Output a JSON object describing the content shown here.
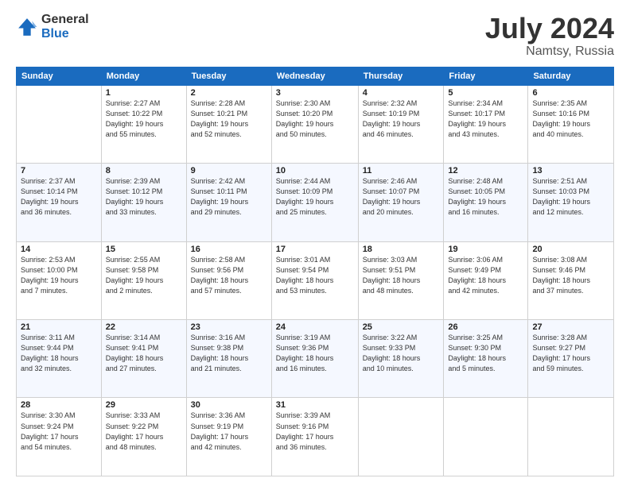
{
  "logo": {
    "general": "General",
    "blue": "Blue"
  },
  "title": {
    "month_year": "July 2024",
    "location": "Namtsy, Russia"
  },
  "calendar": {
    "headers": [
      "Sunday",
      "Monday",
      "Tuesday",
      "Wednesday",
      "Thursday",
      "Friday",
      "Saturday"
    ],
    "weeks": [
      [
        {
          "day": "",
          "info": ""
        },
        {
          "day": "1",
          "info": "Sunrise: 2:27 AM\nSunset: 10:22 PM\nDaylight: 19 hours\nand 55 minutes."
        },
        {
          "day": "2",
          "info": "Sunrise: 2:28 AM\nSunset: 10:21 PM\nDaylight: 19 hours\nand 52 minutes."
        },
        {
          "day": "3",
          "info": "Sunrise: 2:30 AM\nSunset: 10:20 PM\nDaylight: 19 hours\nand 50 minutes."
        },
        {
          "day": "4",
          "info": "Sunrise: 2:32 AM\nSunset: 10:19 PM\nDaylight: 19 hours\nand 46 minutes."
        },
        {
          "day": "5",
          "info": "Sunrise: 2:34 AM\nSunset: 10:17 PM\nDaylight: 19 hours\nand 43 minutes."
        },
        {
          "day": "6",
          "info": "Sunrise: 2:35 AM\nSunset: 10:16 PM\nDaylight: 19 hours\nand 40 minutes."
        }
      ],
      [
        {
          "day": "7",
          "info": "Sunrise: 2:37 AM\nSunset: 10:14 PM\nDaylight: 19 hours\nand 36 minutes."
        },
        {
          "day": "8",
          "info": "Sunrise: 2:39 AM\nSunset: 10:12 PM\nDaylight: 19 hours\nand 33 minutes."
        },
        {
          "day": "9",
          "info": "Sunrise: 2:42 AM\nSunset: 10:11 PM\nDaylight: 19 hours\nand 29 minutes."
        },
        {
          "day": "10",
          "info": "Sunrise: 2:44 AM\nSunset: 10:09 PM\nDaylight: 19 hours\nand 25 minutes."
        },
        {
          "day": "11",
          "info": "Sunrise: 2:46 AM\nSunset: 10:07 PM\nDaylight: 19 hours\nand 20 minutes."
        },
        {
          "day": "12",
          "info": "Sunrise: 2:48 AM\nSunset: 10:05 PM\nDaylight: 19 hours\nand 16 minutes."
        },
        {
          "day": "13",
          "info": "Sunrise: 2:51 AM\nSunset: 10:03 PM\nDaylight: 19 hours\nand 12 minutes."
        }
      ],
      [
        {
          "day": "14",
          "info": "Sunrise: 2:53 AM\nSunset: 10:00 PM\nDaylight: 19 hours\nand 7 minutes."
        },
        {
          "day": "15",
          "info": "Sunrise: 2:55 AM\nSunset: 9:58 PM\nDaylight: 19 hours\nand 2 minutes."
        },
        {
          "day": "16",
          "info": "Sunrise: 2:58 AM\nSunset: 9:56 PM\nDaylight: 18 hours\nand 57 minutes."
        },
        {
          "day": "17",
          "info": "Sunrise: 3:01 AM\nSunset: 9:54 PM\nDaylight: 18 hours\nand 53 minutes."
        },
        {
          "day": "18",
          "info": "Sunrise: 3:03 AM\nSunset: 9:51 PM\nDaylight: 18 hours\nand 48 minutes."
        },
        {
          "day": "19",
          "info": "Sunrise: 3:06 AM\nSunset: 9:49 PM\nDaylight: 18 hours\nand 42 minutes."
        },
        {
          "day": "20",
          "info": "Sunrise: 3:08 AM\nSunset: 9:46 PM\nDaylight: 18 hours\nand 37 minutes."
        }
      ],
      [
        {
          "day": "21",
          "info": "Sunrise: 3:11 AM\nSunset: 9:44 PM\nDaylight: 18 hours\nand 32 minutes."
        },
        {
          "day": "22",
          "info": "Sunrise: 3:14 AM\nSunset: 9:41 PM\nDaylight: 18 hours\nand 27 minutes."
        },
        {
          "day": "23",
          "info": "Sunrise: 3:16 AM\nSunset: 9:38 PM\nDaylight: 18 hours\nand 21 minutes."
        },
        {
          "day": "24",
          "info": "Sunrise: 3:19 AM\nSunset: 9:36 PM\nDaylight: 18 hours\nand 16 minutes."
        },
        {
          "day": "25",
          "info": "Sunrise: 3:22 AM\nSunset: 9:33 PM\nDaylight: 18 hours\nand 10 minutes."
        },
        {
          "day": "26",
          "info": "Sunrise: 3:25 AM\nSunset: 9:30 PM\nDaylight: 18 hours\nand 5 minutes."
        },
        {
          "day": "27",
          "info": "Sunrise: 3:28 AM\nSunset: 9:27 PM\nDaylight: 17 hours\nand 59 minutes."
        }
      ],
      [
        {
          "day": "28",
          "info": "Sunrise: 3:30 AM\nSunset: 9:24 PM\nDaylight: 17 hours\nand 54 minutes."
        },
        {
          "day": "29",
          "info": "Sunrise: 3:33 AM\nSunset: 9:22 PM\nDaylight: 17 hours\nand 48 minutes."
        },
        {
          "day": "30",
          "info": "Sunrise: 3:36 AM\nSunset: 9:19 PM\nDaylight: 17 hours\nand 42 minutes."
        },
        {
          "day": "31",
          "info": "Sunrise: 3:39 AM\nSunset: 9:16 PM\nDaylight: 17 hours\nand 36 minutes."
        },
        {
          "day": "",
          "info": ""
        },
        {
          "day": "",
          "info": ""
        },
        {
          "day": "",
          "info": ""
        }
      ]
    ]
  }
}
